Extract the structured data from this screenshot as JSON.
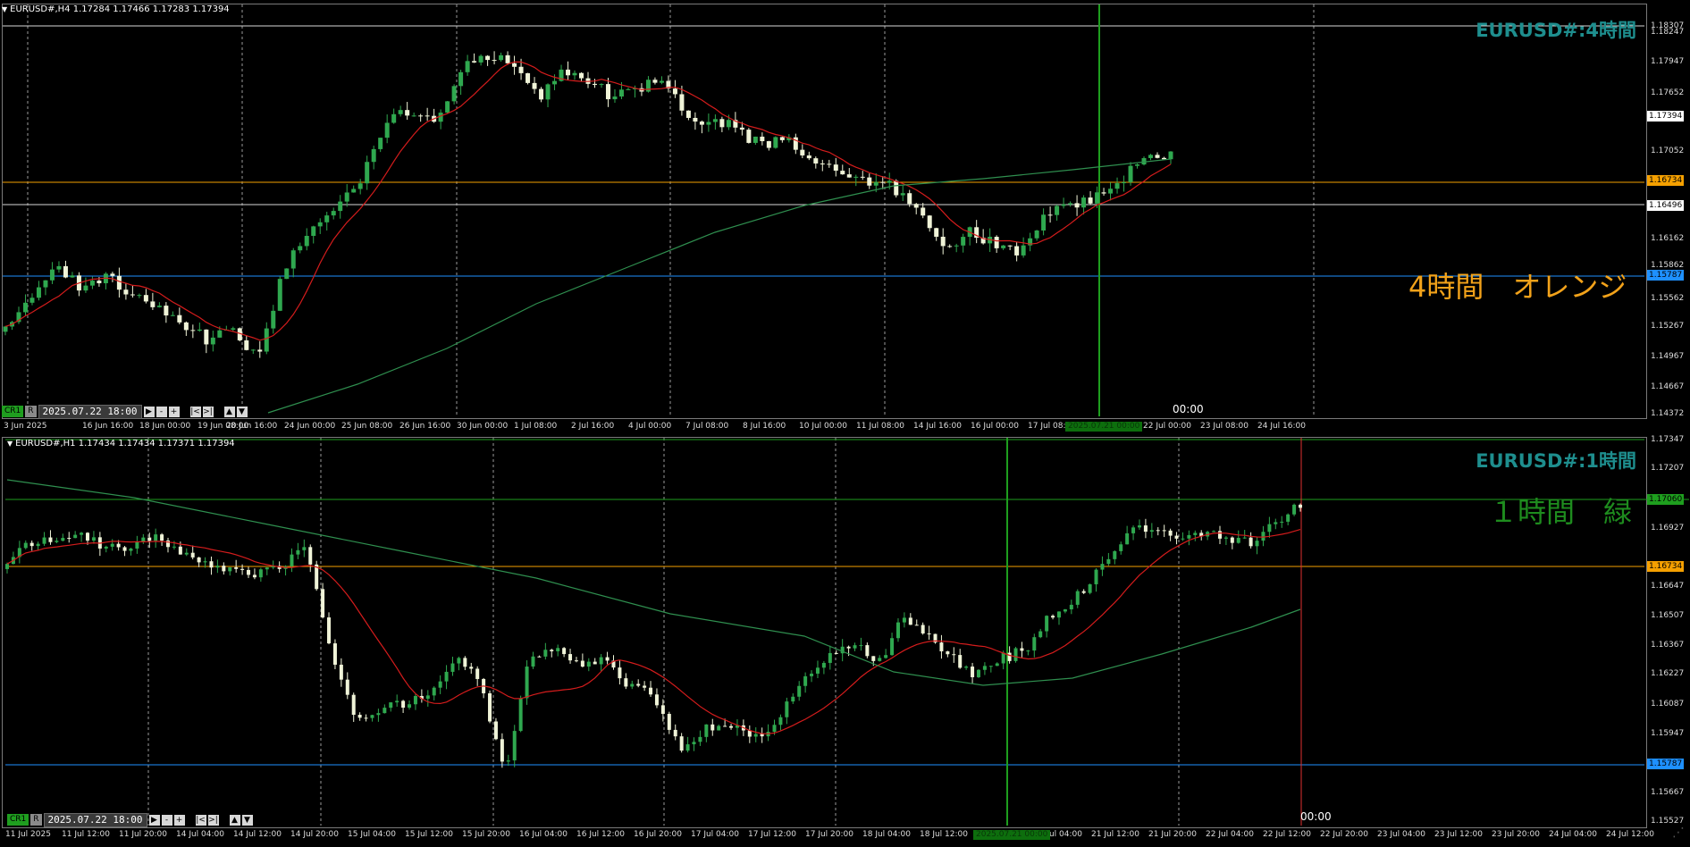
{
  "panel_h4": {
    "header": "EURUSD#,H4  1.17284 1.17466 1.17283 1.17394",
    "watermark": "EURUSD#:4時間",
    "note": "4時間　オレンジ",
    "note_color": "#f2a21a",
    "countdown": "00:00",
    "controls": {
      "badge": "CR1",
      "r_button": "R",
      "date_value": "2025.07.22  18:00",
      "play": "▶",
      "minus": "-",
      "plus": "+",
      "first": "|<",
      "last": ">|",
      "up": "▲",
      "down": "▼"
    },
    "y_labels": [
      "1.18307",
      "1.18247",
      "1.17947",
      "1.17652",
      "1.17394",
      "1.17052",
      "1.16734",
      "1.16496",
      "1.16162",
      "1.15862",
      "1.15787",
      "1.15562",
      "1.15267",
      "1.14967",
      "1.14667",
      "1.14372"
    ],
    "price_tags": [
      {
        "label": "1.17394",
        "color": "#ffffff",
        "text": "#000000"
      },
      {
        "label": "1.16734",
        "color": "#f5a000",
        "text": "#000000"
      },
      {
        "label": "1.16496",
        "color": "#ffffff",
        "text": "#000000"
      },
      {
        "label": "1.15787",
        "color": "#1e90ff",
        "text": "#000000"
      }
    ],
    "x_labels": [
      "3 Jun 2025",
      "16 Jun 16:00",
      "18 Jun 00:00",
      "19 Jun 08:00",
      "20 Jun 16:00",
      "24 Jun 00:00",
      "25 Jun 08:00",
      "26 Jun 16:00",
      "30 Jun 00:00",
      "1 Jul 08:00",
      "2 Jul 16:00",
      "4 Jul 00:00",
      "7 Jul 08:00",
      "8 Jul 16:00",
      "10 Jul 00:00",
      "11 Jul 08:00",
      "14 Jul 16:00",
      "16 Jul 00:00",
      "17 Jul 08:00",
      "22 Jul 00:00",
      "23 Jul 08:00",
      "24 Jul 16:00"
    ],
    "x_badge": "2025.07.21 00:00"
  },
  "panel_h1": {
    "header": "EURUSD#,H1  1.17434 1.17434 1.17371 1.17394",
    "watermark": "EURUSD#:1時間",
    "note": "１時間　緑",
    "note_color": "#1e8c1e",
    "countdown": "00:00",
    "controls": {
      "badge": "CR1",
      "r_button": "R",
      "date_value": "2025.07.22  18:00",
      "play": "▶",
      "minus": "-",
      "plus": "+",
      "first": "|<",
      "last": ">|",
      "up": "▲",
      "down": "▼"
    },
    "y_labels": [
      "1.17347",
      "1.17207",
      "1.17060",
      "1.16927",
      "1.16734",
      "1.16647",
      "1.16507",
      "1.16367",
      "1.16227",
      "1.16087",
      "1.15947",
      "1.15787",
      "1.15667",
      "1.15527"
    ],
    "price_tags": [
      {
        "label": "1.17060",
        "color": "#1e9e1e",
        "text": "#000000"
      },
      {
        "label": "1.16734",
        "color": "#f5a000",
        "text": "#000000"
      },
      {
        "label": "1.15787",
        "color": "#1e90ff",
        "text": "#000000"
      }
    ],
    "x_labels": [
      "11 Jul 2025",
      "11 Jul 12:00",
      "11 Jul 20:00",
      "14 Jul 04:00",
      "14 Jul 12:00",
      "14 Jul 20:00",
      "15 Jul 04:00",
      "15 Jul 12:00",
      "15 Jul 20:00",
      "16 Jul 04:00",
      "16 Jul 12:00",
      "16 Jul 20:00",
      "17 Jul 04:00",
      "17 Jul 12:00",
      "17 Jul 20:00",
      "18 Jul 04:00",
      "18 Jul 12:00",
      "21 Jul 04:00",
      "21 Jul 12:00",
      "21 Jul 20:00",
      "22 Jul 04:00",
      "22 Jul 12:00",
      "22 Jul 20:00",
      "23 Jul 04:00",
      "23 Jul 12:00",
      "23 Jul 20:00",
      "24 Jul 04:00",
      "24 Jul 12:00"
    ],
    "x_badge": "2025.07.21 00:00"
  },
  "colors": {
    "bull": "#2fa84f",
    "bear": "#f0f4d8",
    "ma_fast": "#d41c1c",
    "ma_slow": "#2f8f4f",
    "vline": "#1e9e1e",
    "grid": "#9a9a9a"
  }
}
